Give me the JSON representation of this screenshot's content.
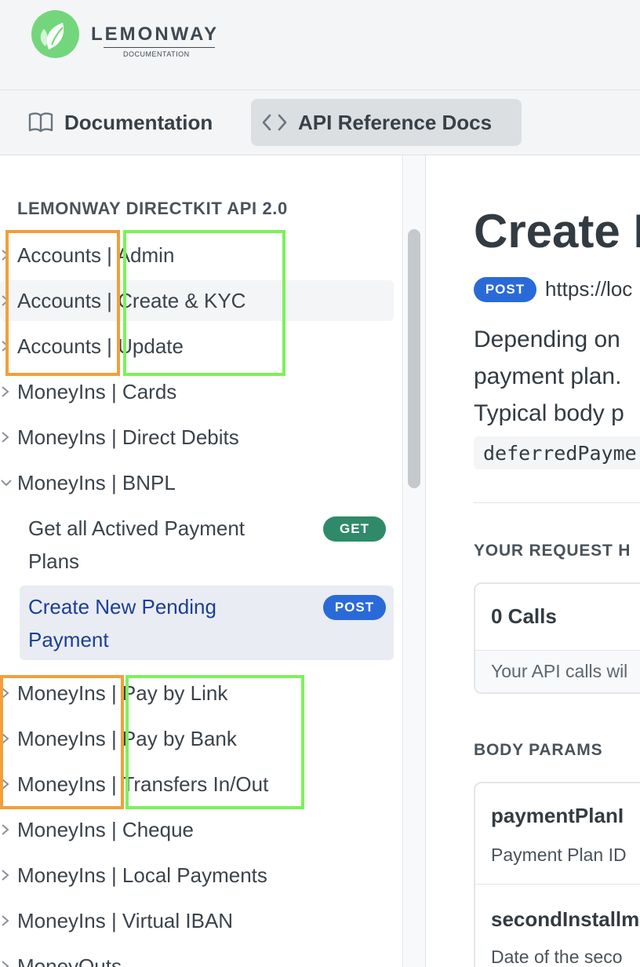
{
  "brand": {
    "name": "LEMONWAY",
    "sub": "DOCUMENTATION"
  },
  "tabs": [
    {
      "label": "Documentation",
      "icon": "book-icon"
    },
    {
      "label": "API Reference Docs",
      "icon": "code-brackets-icon"
    }
  ],
  "sidebar": {
    "heading": "LEMONWAY DIRECTKIT API 2.0",
    "items": [
      {
        "label": "Accounts | Admin",
        "expanded": false
      },
      {
        "label": "Accounts | Create & KYC",
        "expanded": false
      },
      {
        "label": "Accounts | Update",
        "expanded": false
      },
      {
        "label": "MoneyIns | Cards",
        "expanded": false
      },
      {
        "label": "MoneyIns | Direct Debits",
        "expanded": false
      },
      {
        "label": "MoneyIns | BNPL",
        "expanded": true
      },
      {
        "label": "MoneyIns | Pay by Link",
        "expanded": false
      },
      {
        "label": "MoneyIns | Pay by Bank",
        "expanded": false
      },
      {
        "label": "MoneyIns | Transfers In/Out",
        "expanded": false
      },
      {
        "label": "MoneyIns | Cheque",
        "expanded": false
      },
      {
        "label": "MoneyIns | Local Payments",
        "expanded": false
      },
      {
        "label": "MoneyIns | Virtual IBAN",
        "expanded": false
      },
      {
        "label": "MoneyOuts",
        "expanded": false
      }
    ],
    "bnpl_children": [
      {
        "line1": "Get all Actived Payment",
        "line2": "Plans",
        "method": "GET",
        "active": false
      },
      {
        "line1": "Create New Pending",
        "line2": "Payment",
        "method": "POST",
        "active": true
      }
    ]
  },
  "main": {
    "title": "Create N",
    "method": "POST",
    "url": "https://loc",
    "desc_lines": [
      "Depending on",
      "payment plan.",
      "Typical body p"
    ],
    "code": "deferredPayme",
    "history_heading": "YOUR REQUEST H",
    "calls": "0 Calls",
    "calls_note": "Your API calls wil",
    "body_heading": "BODY PARAMS",
    "params": [
      {
        "name": "paymentPlanI",
        "desc": "Payment Plan ID"
      },
      {
        "name": "secondInstallm",
        "desc": "Date of the seco"
      }
    ]
  },
  "colors": {
    "accent_post": "#2a6ad8",
    "accent_get": "#2f8a6a",
    "annotation_orange": "#f0a03a",
    "annotation_green": "#7cf15a",
    "logo_green": "#73d67c"
  }
}
